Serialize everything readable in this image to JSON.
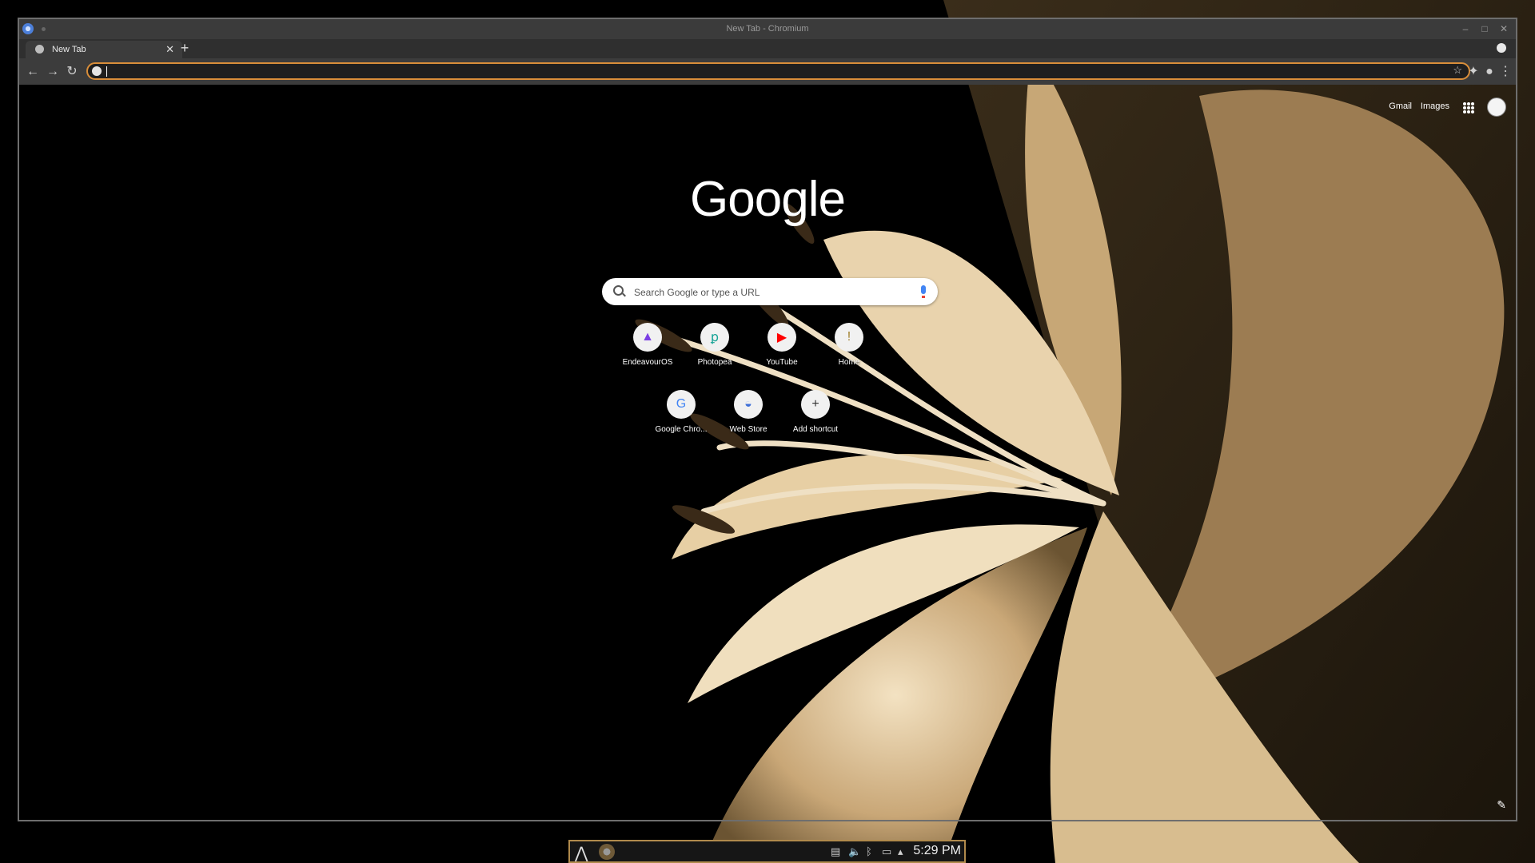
{
  "window": {
    "title": "New Tab - Chromium"
  },
  "tab": {
    "label": "New Tab"
  },
  "omnibox": {
    "value": ""
  },
  "ntp": {
    "links": [
      "Gmail",
      "Images"
    ],
    "logo": "Google",
    "search_placeholder": "Search Google or type a URL",
    "shortcuts": [
      {
        "label": "EndeavourOS",
        "icon": "endeavouros-icon",
        "glyph": "▲",
        "color": "#7b3fe4"
      },
      {
        "label": "Photopea",
        "icon": "photopea-icon",
        "glyph": "ꝑ",
        "color": "#18a497"
      },
      {
        "label": "YouTube",
        "icon": "youtube-icon",
        "glyph": "▶",
        "color": "#ff0000"
      },
      {
        "label": "Home",
        "icon": "home-icon",
        "glyph": "!",
        "color": "#a07f2a"
      },
      {
        "label": "Google Chro...",
        "icon": "google-icon",
        "glyph": "G",
        "color": "#4285f4"
      },
      {
        "label": "Web Store",
        "icon": "web-store-icon",
        "glyph": "◒",
        "color": "#3f6fd8"
      },
      {
        "label": "Add shortcut",
        "icon": "plus-icon",
        "glyph": "+",
        "color": "#333333"
      }
    ]
  },
  "taskbar": {
    "clock": "5:29 PM"
  },
  "colors": {
    "accent": "#d98e3a",
    "toolbar": "#3c3c3c",
    "titlebar": "#3b3b3b"
  }
}
